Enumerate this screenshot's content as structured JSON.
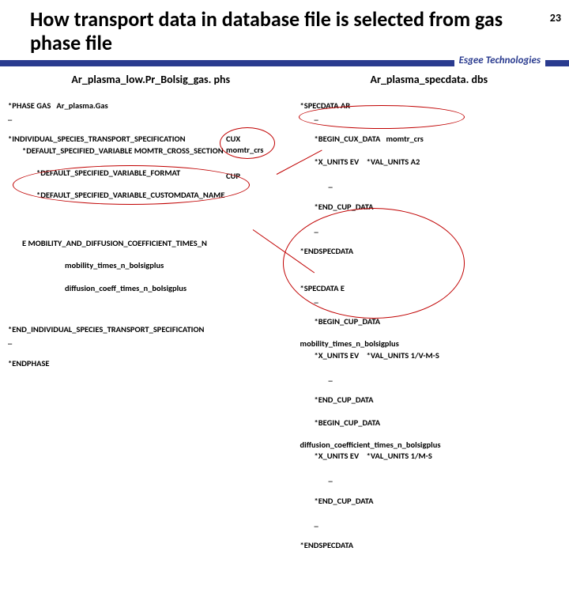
{
  "page_number": "23",
  "title": "How transport data in database file is selected from gas phase file",
  "brand": "Esgee Technologies",
  "left": {
    "heading": "Ar_plasma_low.Pr_Bolsig_gas. phs",
    "l0": "*PHASE GAS   Ar_plasma.Gas",
    "l1": "*INDIVIDUAL_SPECIES_TRANSPORT_SPECIFICATION",
    "l2": "*DEFAULT_SPECIFIED_VARIABLE MOMTR_CROSS_SECTION",
    "l3": "*DEFAULT_SPECIFIED_VARIABLE_FORMAT",
    "l3r": "CUX",
    "l4": "*DEFAULT_SPECIFIED_VARIABLE_CUSTOMDATA_NAME",
    "l4r": "momtr_crs",
    "l5": "E MOBILITY_AND_DIFFUSION_COEFFICIENT_TIMES_N",
    "l5r": "CUP",
    "l6": "mobility_times_n_bolsigplus",
    "l7": "diffusion_coeff_times_n_bolsigplus",
    "l8": "*END_INDIVIDUAL_SPECIES_TRANSPORT_SPECIFICATION",
    "l9": "*ENDPHASE"
  },
  "right": {
    "heading": "Ar_plasma_specdata. dbs",
    "r0": "*SPECDATA AR",
    "r1": "*BEGIN_CUX_DATA   momtr_crs",
    "r2": "*X_UNITS EV    *VAL_UNITS A2",
    "r3": "*END_CUP_DATA",
    "r4": "*ENDSPECDATA",
    "r5": "*SPECDATA E",
    "r6": "*BEGIN_CUP_DATA",
    "r7": "mobility_times_n_bolsigplus",
    "r8": "*X_UNITS EV    *VAL_UNITS 1/V-M-S",
    "r9": "*END_CUP_DATA",
    "r10": "*BEGIN_CUP_DATA",
    "r11": "diffusion_coefficient_times_n_bolsigplus",
    "r12": "*X_UNITS EV    *VAL_UNITS 1/M-S",
    "r13": "*END_CUP_DATA",
    "r14": "*ENDSPECDATA"
  }
}
